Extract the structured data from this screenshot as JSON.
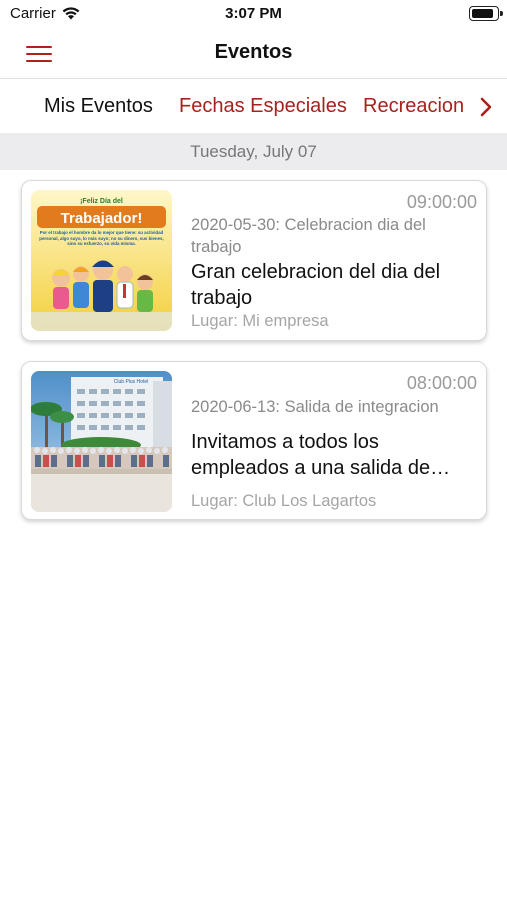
{
  "status_bar": {
    "carrier": "Carrier",
    "time": "3:07 PM",
    "battery_level": 0.9
  },
  "nav": {
    "title": "Eventos",
    "menu_icon": "hamburger-menu-icon"
  },
  "tabs": [
    {
      "label": "Mis Eventos",
      "active": true
    },
    {
      "label": "Fechas Especiales",
      "active": false
    },
    {
      "label": "Recreacion",
      "active": false
    }
  ],
  "date_header": "Tuesday, July 07",
  "events": [
    {
      "time": "09:00:00",
      "subtitle": "2020-05-30: Celebracion dia del trabajo",
      "title": "Gran celebracion del dia del trabajo",
      "location": "Lugar: Mi empresa",
      "thumb_text": {
        "line1": "¡Feliz Día del",
        "line2": "Trabajador!",
        "body": "Por el trabajo el hombre da lo mejor que tiene: su actividad personal, algo suyo, lo más suyo; no su dinero, sus bienes, sino su esfuerzo, su vida misma."
      }
    },
    {
      "time": "08:00:00",
      "subtitle": "2020-06-13: Salida de integracion",
      "title": "Invitamos a todos los empleados a una salida de integracion",
      "location": "Lugar: Club Los Lagartos",
      "thumb_text": {
        "sign": "Club Plus Hotel"
      }
    }
  ],
  "colors": {
    "accent": "#a8221d",
    "date_header_bg": "#ececef",
    "muted_text": "#8a8a8a"
  }
}
